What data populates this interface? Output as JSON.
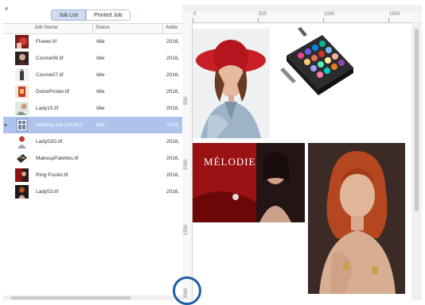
{
  "toolbar": {
    "collapse_left": "«",
    "collapse_right": "»"
  },
  "tabs": [
    {
      "label": "Job List"
    },
    {
      "label": "Printed Job"
    }
  ],
  "columns": {
    "name": "Job Name",
    "status": "Status",
    "added": "Adde"
  },
  "jobs": [
    {
      "name": "Flower.tif",
      "status": "Idle",
      "added": "2016,",
      "icon": "image-thumb-red"
    },
    {
      "name": "Cosme06.tif",
      "status": "Idle",
      "added": "2016,",
      "icon": "image-thumb-portrait"
    },
    {
      "name": "Cosme07.tif",
      "status": "Idle",
      "added": "2016,",
      "icon": "image-thumb-bottle"
    },
    {
      "name": "DolcePoster.tif",
      "status": "Idle",
      "added": "2016,",
      "icon": "image-thumb-poster"
    },
    {
      "name": "Lady15.tif",
      "status": "Idle",
      "added": "2016,",
      "icon": "image-thumb-lady"
    },
    {
      "name": "Nesting Job [2016/1!",
      "status": "Idle",
      "added": "2016,",
      "icon": "nesting-job-icon",
      "expander": "▸"
    },
    {
      "name": "Lady53G.tif",
      "status": "",
      "added": "2016,",
      "icon": "image-thumb-lady-red"
    },
    {
      "name": "MakeupPalettes.tif",
      "status": "",
      "added": "2016,",
      "icon": "image-thumb-palette"
    },
    {
      "name": "Ring Poster.tif",
      "status": "",
      "added": "2016,",
      "icon": "image-thumb-ring"
    },
    {
      "name": "Lady53.tif",
      "status": "",
      "added": "2016,",
      "icon": "image-thumb-lady-dark"
    }
  ],
  "ruler": {
    "top_labels": [
      "0",
      "500",
      "1000",
      "1500"
    ],
    "left_labels": [
      "500",
      "1000",
      "1500",
      "2000"
    ]
  },
  "preview": {
    "poster_title": "MÉLODIE"
  }
}
